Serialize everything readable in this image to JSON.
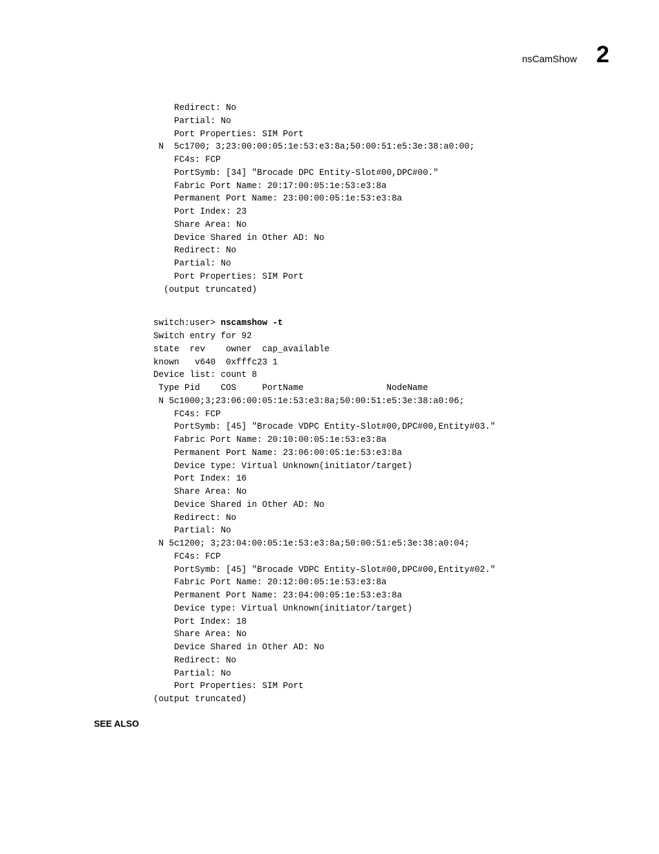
{
  "header": {
    "title": "nsCamShow",
    "number": "2"
  },
  "code_block_1": [
    "    Redirect: No",
    "    Partial: No",
    "    Port Properties: SIM Port",
    " N  5c1700; 3;23:00:00:05:1e:53:e3:8a;50:00:51:e5:3e:38:a0:00;",
    "    FC4s: FCP",
    "    PortSymb: [34] \"Brocade DPC Entity-Slot#00,DPC#00.\"",
    "    Fabric Port Name: 20:17:00:05:1e:53:e3:8a",
    "    Permanent Port Name: 23:00:00:05:1e:53:e3:8a",
    "    Port Index: 23",
    "    Share Area: No",
    "    Device Shared in Other AD: No",
    "    Redirect: No",
    "    Partial: No",
    "    Port Properties: SIM Port",
    "  (output truncated)"
  ],
  "prompt": {
    "prefix": "switch:user> ",
    "command": "nscamshow -t"
  },
  "code_block_2": [
    "Switch entry for 92",
    "state  rev    owner  cap_available",
    "known   v640  0xfffc23 1",
    "Device list: count 8",
    " Type Pid    COS     PortName                NodeName",
    " N 5c1000;3;23:06:00:05:1e:53:e3:8a;50:00:51:e5:3e:38:a0:06;",
    "    FC4s: FCP",
    "    PortSymb: [45] \"Brocade VDPC Entity-Slot#00,DPC#00,Entity#03.\"",
    "    Fabric Port Name: 20:10:00:05:1e:53:e3:8a",
    "    Permanent Port Name: 23:06:00:05:1e:53:e3:8a",
    "    Device type: Virtual Unknown(initiator/target)",
    "    Port Index: 16",
    "    Share Area: No",
    "    Device Shared in Other AD: No",
    "    Redirect: No",
    "    Partial: No",
    " N 5c1200; 3;23:04:00:05:1e:53:e3:8a;50:00:51:e5:3e:38:a0:04;",
    "    FC4s: FCP",
    "    PortSymb: [45] \"Brocade VDPC Entity-Slot#00,DPC#00,Entity#02.\"",
    "    Fabric Port Name: 20:12:00:05:1e:53:e3:8a",
    "    Permanent Port Name: 23:04:00:05:1e:53:e3:8a",
    "    Device type: Virtual Unknown(initiator/target)",
    "    Port Index: 18",
    "    Share Area: No",
    "    Device Shared in Other AD: No",
    "    Redirect: No",
    "    Partial: No",
    "    Port Properties: SIM Port",
    "(output truncated)"
  ],
  "see_also_label": "SEE ALSO"
}
